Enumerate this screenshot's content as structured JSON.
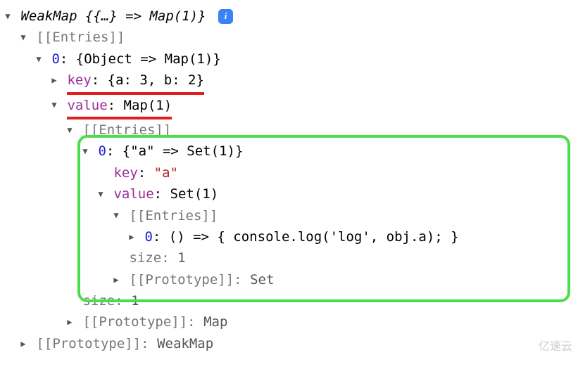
{
  "root": {
    "label": "WeakMap {{…} => Map(1)}",
    "info_tooltip": "i"
  },
  "entries_label": "[[Entries]]",
  "entry0": {
    "index": "0",
    "summary": "{Object => Map(1)}",
    "key_label": "key",
    "key_value": "{a: 3, b: 2}",
    "value_label": "value",
    "value_summary": "Map(1)"
  },
  "inner": {
    "entries_label": "[[Entries]]",
    "entry0": {
      "index": "0",
      "summary": "{\"a\" => Set(1)}",
      "key_label": "key",
      "key_value": "\"a\"",
      "value_label": "value",
      "value_summary": "Set(1)"
    },
    "set": {
      "entries_label": "[[Entries]]",
      "entry0_index": "0",
      "entry0_value": "() => { console.log('log', obj.a); }",
      "size_label": "size",
      "size_value": "1",
      "proto_label": "[[Prototype]]",
      "proto_value": "Set"
    },
    "size_label": "size",
    "size_value": "1",
    "proto_label": "[[Prototype]]",
    "proto_value": "Map"
  },
  "proto_label": "[[Prototype]]",
  "proto_value": "WeakMap",
  "watermark": "亿速云"
}
